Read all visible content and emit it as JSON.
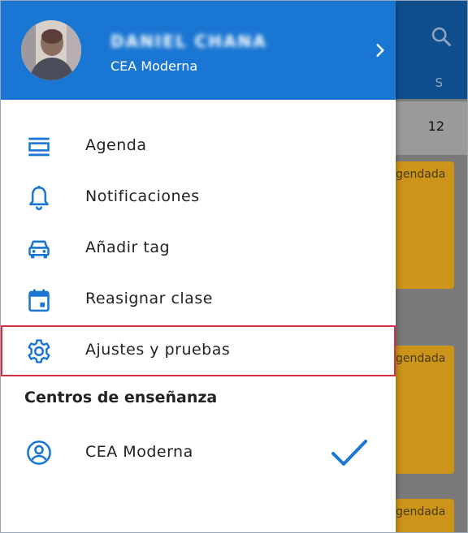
{
  "background": {
    "column_label": "S",
    "row_number": "12",
    "card_labels": [
      "gendada",
      "gendada",
      "gendada"
    ]
  },
  "drawer": {
    "user": {
      "name": "DANIEL CHANA",
      "center": "CEA Moderna"
    },
    "menu": [
      {
        "label": "Agenda",
        "icon": "agenda-icon"
      },
      {
        "label": "Notificaciones",
        "icon": "bell-icon"
      },
      {
        "label": "Añadir tag",
        "icon": "car-icon"
      },
      {
        "label": "Reasignar clase",
        "icon": "calendar-icon"
      },
      {
        "label": "Ajustes y pruebas",
        "icon": "gear-icon"
      }
    ],
    "centers_section": {
      "title": "Centros de enseñanza",
      "items": [
        {
          "label": "CEA Moderna",
          "icon": "account-circle-icon",
          "selected": true
        }
      ]
    }
  },
  "colors": {
    "primary": "#1976d2",
    "icon": "#1976d2",
    "highlight_border": "#d03040",
    "card": "#cc9419"
  }
}
